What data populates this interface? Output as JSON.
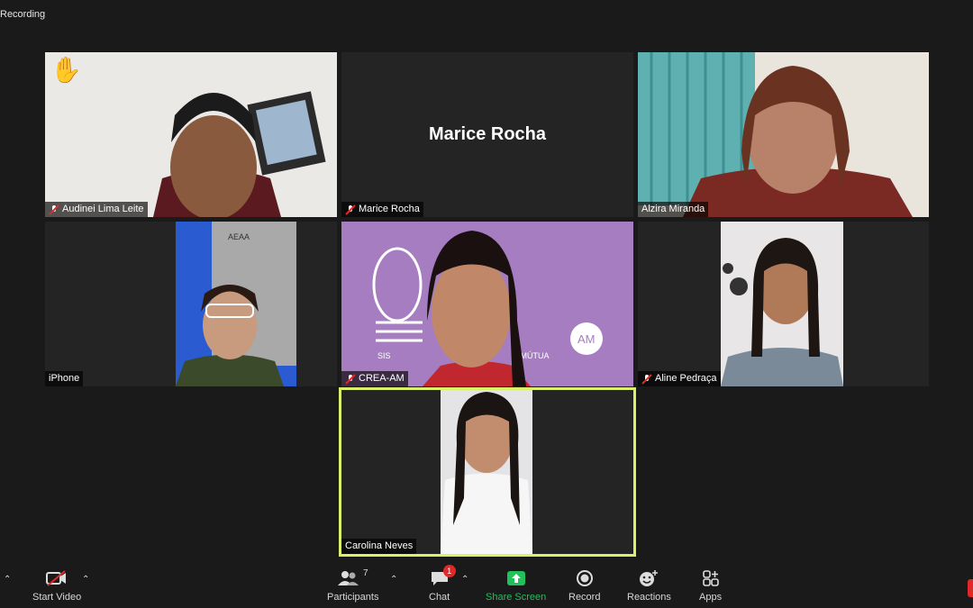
{
  "recording_label": "Recording",
  "participants": [
    {
      "name": "Audinei Lima Leite",
      "muted": true,
      "hand_raised": true
    },
    {
      "name": "Marice Rocha",
      "muted": true,
      "video_off": true
    },
    {
      "name": "Alzira Miranda",
      "muted": false
    },
    {
      "name": "iPhone",
      "muted": false
    },
    {
      "name": "CREA-AM",
      "muted": true
    },
    {
      "name": "Aline  Pedraça",
      "muted": true
    },
    {
      "name": "Carolina Neves",
      "muted": false,
      "active_speaker": true
    }
  ],
  "background_text": {
    "crea_logo": "AM",
    "crea_sub": "SIS",
    "crea_sub2": "E MÚTUA",
    "plaque": "AEAA"
  },
  "toolbar": {
    "start_video": "Start Video",
    "participants": "Participants",
    "participants_count": "7",
    "chat": "Chat",
    "chat_badge": "1",
    "share_screen": "Share Screen",
    "record": "Record",
    "reactions": "Reactions",
    "apps": "Apps"
  },
  "colors": {
    "share_green": "#21c05a",
    "active_border": "#d9f06a",
    "muted_red": "#e02828"
  }
}
